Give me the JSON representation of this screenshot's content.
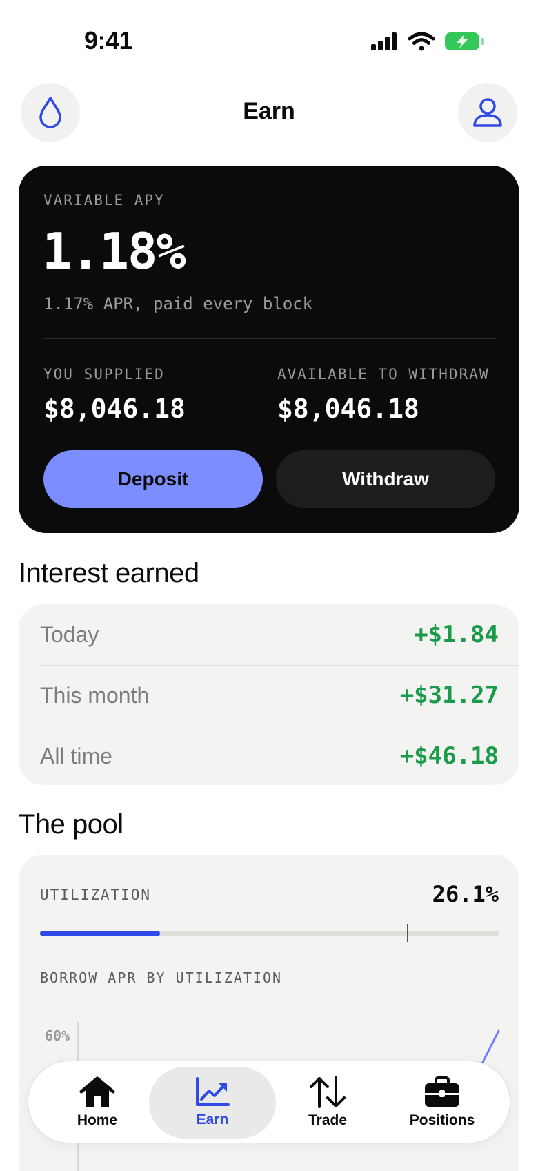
{
  "status": {
    "time": "9:41"
  },
  "header": {
    "title": "Earn",
    "left_icon": "drop-icon",
    "right_icon": "profile-icon"
  },
  "hero": {
    "label": "VARIABLE APY",
    "apy": "1.18%",
    "subtitle": "1.17% APR, paid every block",
    "supplied_label": "YOU SUPPLIED",
    "supplied_value": "$8,046.18",
    "available_label": "AVAILABLE TO WITHDRAW",
    "available_value": "$8,046.18",
    "deposit_label": "Deposit",
    "withdraw_label": "Withdraw"
  },
  "interest": {
    "title": "Interest earned",
    "rows": [
      {
        "label": "Today",
        "value": "+$1.84"
      },
      {
        "label": "This month",
        "value": "+$31.27"
      },
      {
        "label": "All time",
        "value": "+$46.18"
      }
    ]
  },
  "pool": {
    "title": "The pool",
    "utilization_label": "UTILIZATION",
    "utilization_value": "26.1%",
    "utilization_fraction": 0.261,
    "kink_fraction": 0.8,
    "chart_label": "BORROW APR BY UTILIZATION",
    "chart_tick": "60%"
  },
  "tabs": [
    {
      "label": "Home",
      "icon": "home-icon"
    },
    {
      "label": "Earn",
      "icon": "chart-up-icon",
      "active": true
    },
    {
      "label": "Trade",
      "icon": "swap-arrows-icon"
    },
    {
      "label": "Positions",
      "icon": "briefcase-icon"
    }
  ],
  "colors": {
    "accent": "#2f4ae8",
    "deposit": "#7b8dff",
    "positive": "#1a9a4b",
    "card_dark": "#0b0b0b",
    "card_light": "#f3f3f1"
  }
}
